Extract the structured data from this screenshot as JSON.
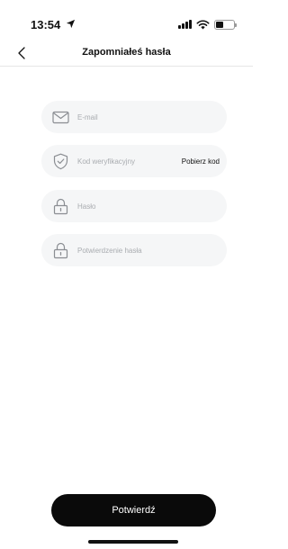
{
  "status_bar": {
    "time": "13:54"
  },
  "nav": {
    "title": "Zapomniałeś hasła",
    "back_icon": "chevron-left-icon"
  },
  "form": {
    "email": {
      "placeholder": "E-mail",
      "icon": "envelope-icon"
    },
    "code": {
      "placeholder": "Kod weryfikacyjny",
      "icon": "shield-check-icon",
      "get_code_label": "Pobierz kod"
    },
    "password": {
      "placeholder": "Hasło",
      "icon": "lock-icon"
    },
    "password_confirm": {
      "placeholder": "Potwierdzenie hasła",
      "icon": "lock-icon"
    }
  },
  "confirm_button": {
    "label": "Potwierdź"
  },
  "colors": {
    "field_background": "#f5f6f7",
    "placeholder_text": "#a9acb0",
    "button_background": "#0a0a0a",
    "button_text": "#ffffff"
  }
}
